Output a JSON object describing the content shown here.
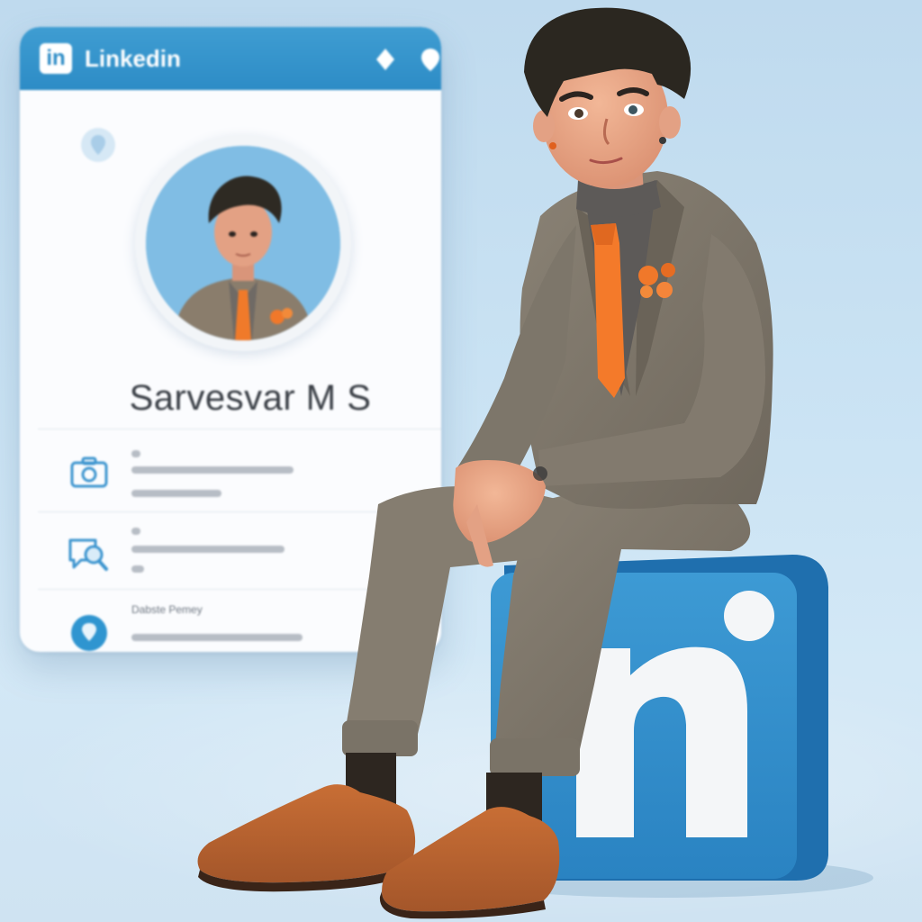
{
  "card": {
    "brand_mark": "in",
    "brand_name": "Linkedin",
    "header_icons": [
      "diamond-icon",
      "location-pin-icon"
    ],
    "profile_name": "Sarvesvar M S",
    "rows": [
      {
        "icon": "briefcase-icon"
      },
      {
        "icon": "chat-search-icon"
      },
      {
        "icon": "map-pin-icon",
        "label": "Dabste Pemey"
      }
    ]
  },
  "colors": {
    "linkedin_blue": "#2d8cc6",
    "tie_orange": "#f47a2a",
    "suit_gray": "#7a7266",
    "shoe_brown": "#b8602a",
    "background": "#c9e2f3"
  }
}
